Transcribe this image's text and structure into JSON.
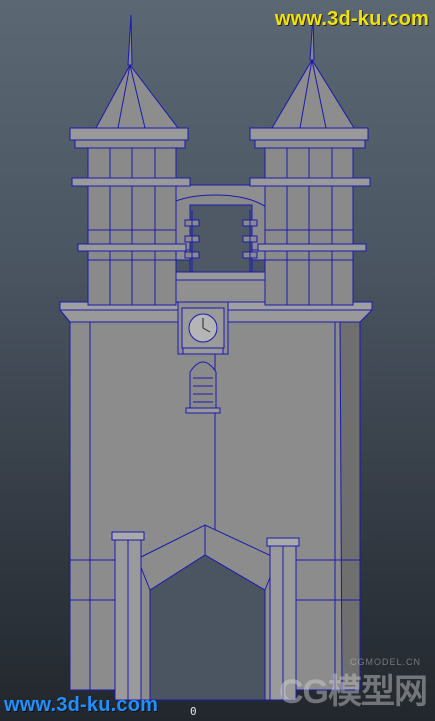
{
  "watermarks": {
    "top": "www.3d-ku.com",
    "bottom": "www.3d-ku.com",
    "cg_logo": "CG模型网",
    "cg_domain": "CGMODEL.CN"
  },
  "viewport": {
    "axis_label": "0"
  },
  "colors": {
    "wireframe": "#1a1ab0",
    "surface": "#8a8a8a",
    "surface_dark": "#6f6f6f"
  },
  "scene": {
    "object": "tower-model",
    "icons": [
      "clock-icon"
    ]
  }
}
